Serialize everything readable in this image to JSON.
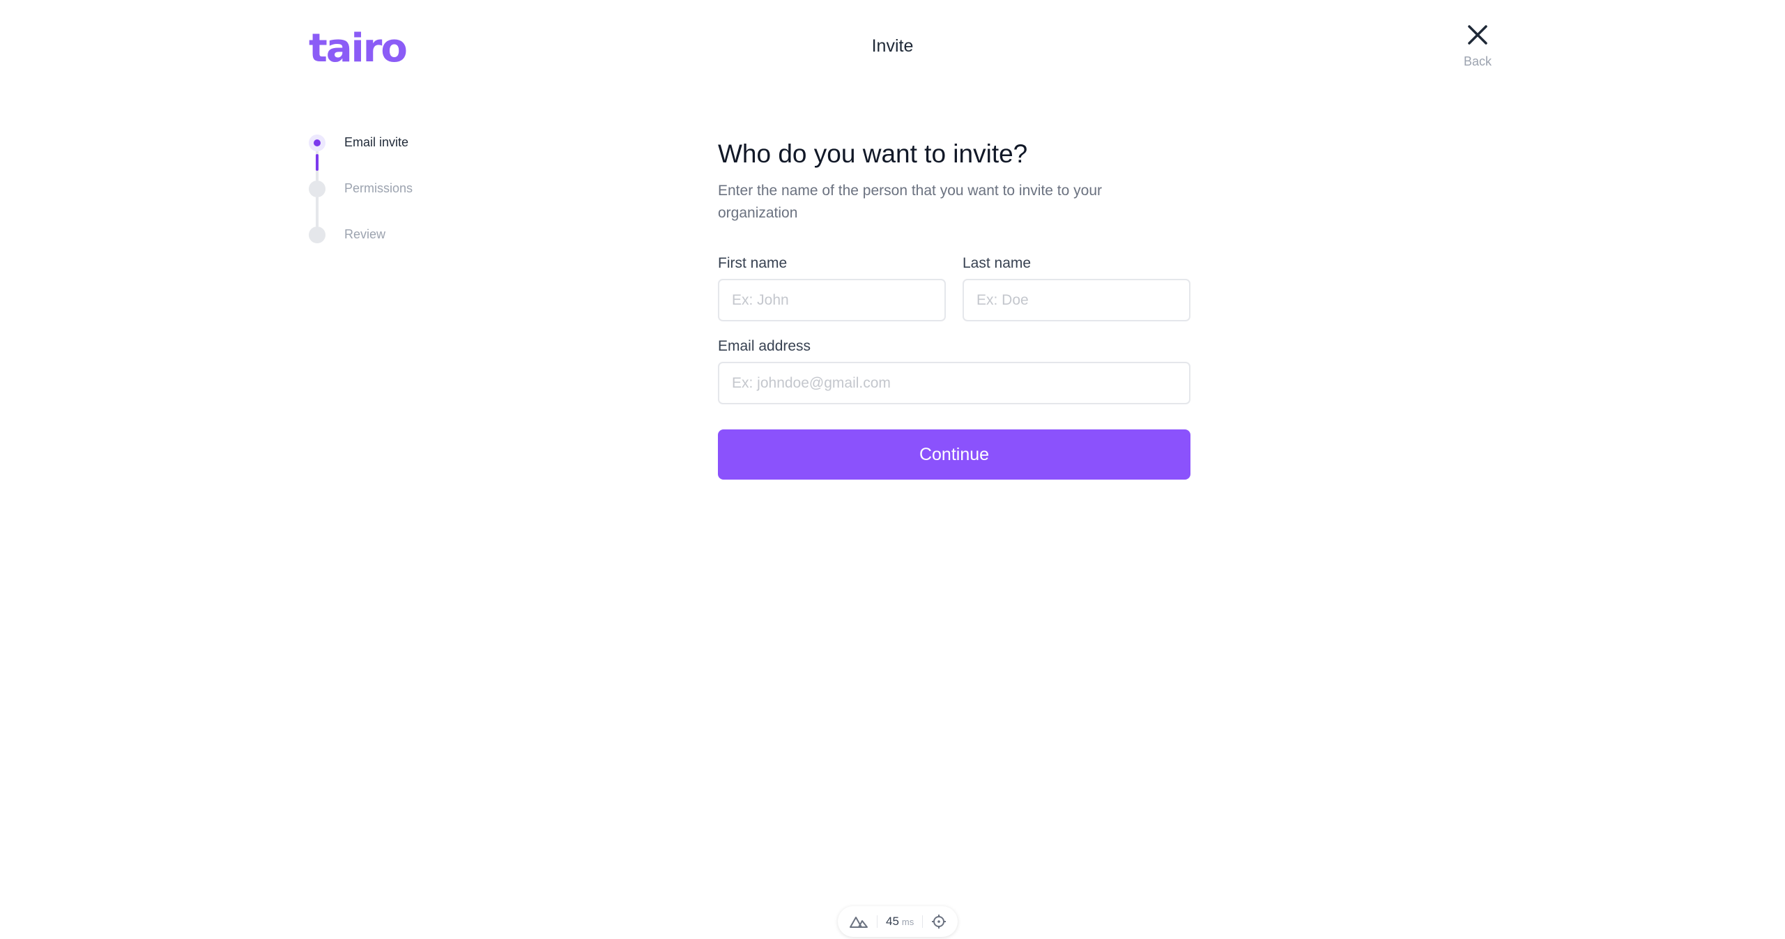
{
  "header": {
    "logo": "tairo",
    "title": "Invite",
    "back_label": "Back"
  },
  "stepper": {
    "steps": [
      {
        "label": "Email invite",
        "state": "active"
      },
      {
        "label": "Permissions",
        "state": "upcoming"
      },
      {
        "label": "Review",
        "state": "upcoming"
      }
    ]
  },
  "form": {
    "title": "Who do you want to invite?",
    "subtitle": "Enter the name of the person that you want to invite to your organization",
    "first_name": {
      "label": "First name",
      "placeholder": "Ex: John",
      "value": ""
    },
    "last_name": {
      "label": "Last name",
      "placeholder": "Ex: Doe",
      "value": ""
    },
    "email": {
      "label": "Email address",
      "placeholder": "Ex: johndoe@gmail.com",
      "value": ""
    },
    "continue_label": "Continue"
  },
  "devbar": {
    "timing_value": "45",
    "timing_unit": "ms"
  },
  "colors": {
    "accent": "#8b52fc",
    "accent_dark": "#7c3aed"
  }
}
